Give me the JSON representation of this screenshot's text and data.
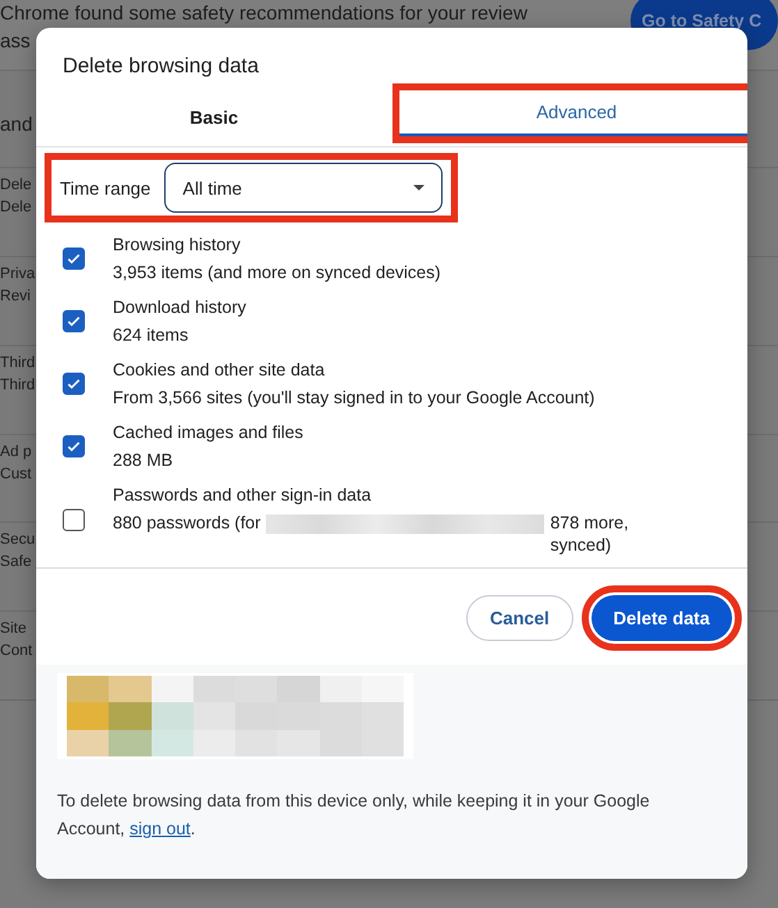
{
  "background": {
    "banner": "Chrome found some safety recommendations for your review",
    "banner_line_2": "ass",
    "button": "Go to Safety C",
    "section_heading": "and",
    "rows": [
      {
        "title": "Dele",
        "subtitle": "Dele"
      },
      {
        "title": "Priva",
        "subtitle": "Revi"
      },
      {
        "title": "Third",
        "subtitle": "Third"
      },
      {
        "title": "Ad p",
        "subtitle": "Cust"
      },
      {
        "title": "Secu",
        "subtitle": "Safe"
      },
      {
        "title": "Site",
        "subtitle": "Cont"
      }
    ]
  },
  "dialog": {
    "title": "Delete browsing data",
    "tabs": [
      {
        "label": "Basic",
        "selected": false,
        "highlighted": false
      },
      {
        "label": "Advanced",
        "selected": true,
        "highlighted": true
      }
    ],
    "time_range": {
      "label": "Time range",
      "value": "All time",
      "highlighted": true
    },
    "options": [
      {
        "title": "Browsing history",
        "description": "3,953 items (and more on synced devices)",
        "checked": true
      },
      {
        "title": "Download history",
        "description": "624 items",
        "checked": true
      },
      {
        "title": "Cookies and other site data",
        "description": "From 3,566 sites (you'll stay signed in to your Google Account)",
        "checked": true
      },
      {
        "title": "Cached images and files",
        "description": "288 MB",
        "checked": true
      },
      {
        "title": "Passwords and other sign-in data",
        "description": "880 passwords (for",
        "description_after_redaction": "878 more, synced)",
        "checked": false
      }
    ],
    "buttons": [
      {
        "label": "Cancel",
        "kind": "secondary",
        "highlighted": false
      },
      {
        "label": "Delete data",
        "kind": "primary",
        "highlighted": true
      }
    ],
    "footer": {
      "text": "To delete browsing data from this device only, while keeping it in your Google Account,",
      "link": "sign out",
      "after": "."
    }
  }
}
